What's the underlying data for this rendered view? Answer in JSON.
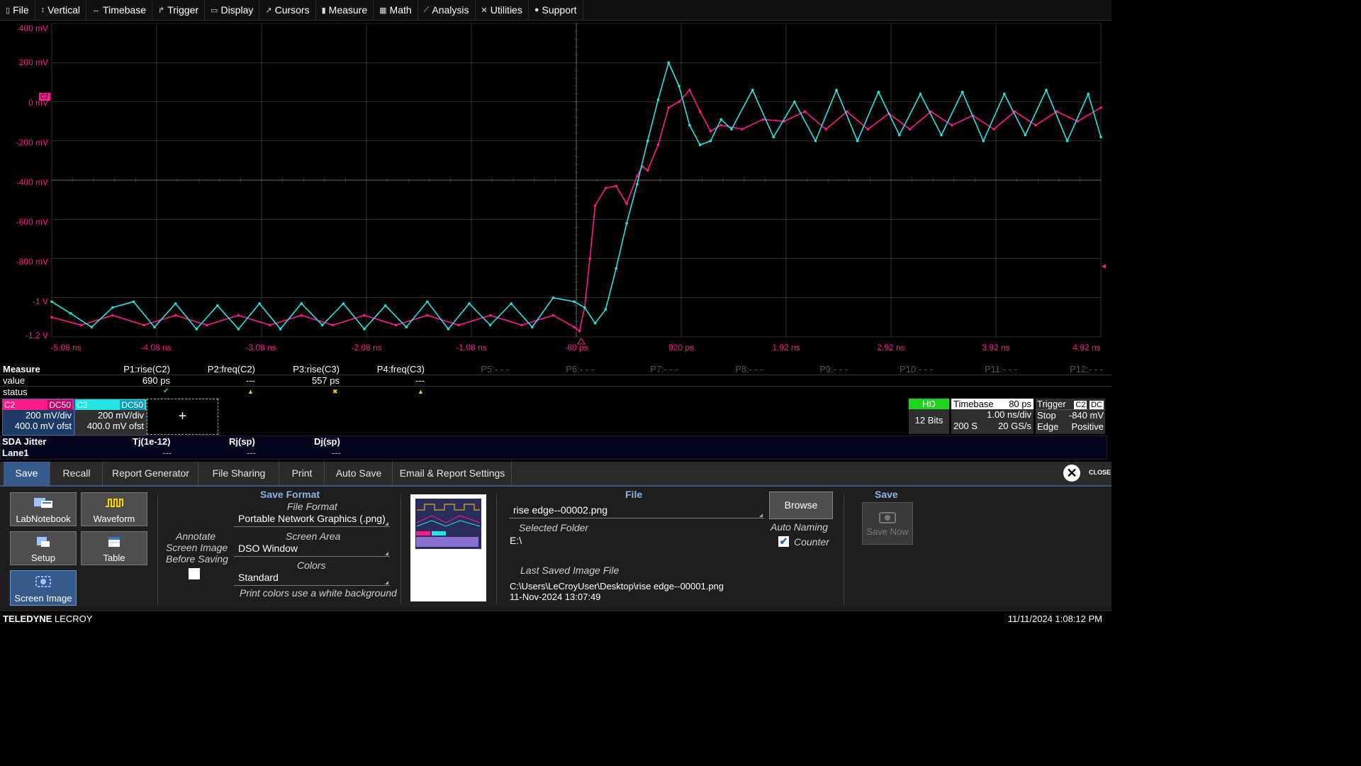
{
  "menu": [
    {
      "icon": "file-icon",
      "glyph": "▯",
      "label": "File"
    },
    {
      "icon": "vertical-icon",
      "glyph": "↕",
      "label": "Vertical"
    },
    {
      "icon": "timebase-icon",
      "glyph": "↔",
      "label": "Timebase"
    },
    {
      "icon": "trigger-icon",
      "glyph": "↱",
      "label": "Trigger"
    },
    {
      "icon": "display-icon",
      "glyph": "▭",
      "label": "Display"
    },
    {
      "icon": "cursors-icon",
      "glyph": "↗",
      "label": "Cursors"
    },
    {
      "icon": "measure-icon",
      "glyph": "▮",
      "label": "Measure"
    },
    {
      "icon": "math-icon",
      "glyph": "▦",
      "label": "Math"
    },
    {
      "icon": "analysis-icon",
      "glyph": "⟋",
      "label": "Analysis"
    },
    {
      "icon": "utilities-icon",
      "glyph": "✕",
      "label": "Utilities"
    },
    {
      "icon": "support-icon",
      "glyph": "●",
      "label": "Support"
    }
  ],
  "grid": {
    "y_labels": [
      "400 mV",
      "200 mV",
      "0 mV",
      "-200 mV",
      "-400 mV",
      "-600 mV",
      "-800 mV",
      "-1 V",
      "-1.2 V"
    ],
    "x_labels": [
      "-5.08 ns",
      "-4.08 ns",
      "-3.08 ns",
      "-2.08 ns",
      "-1.08 ns",
      "-80 ps",
      "920 ps",
      "1.92 ns",
      "2.92 ns",
      "3.92 ns",
      "4.92 ns"
    ],
    "c2_marker": "C2",
    "colors": {
      "c2": "#ff1a8c",
      "c3": "#22e5e5",
      "grid": "#555555"
    }
  },
  "chart_data": {
    "type": "line",
    "xlabel": "",
    "ylabel": "",
    "xlim": [
      -5.08,
      4.92
    ],
    "ylim": [
      -1.2,
      0.4
    ],
    "x_unit": "ns",
    "y_unit": "V",
    "series": [
      {
        "name": "C2",
        "color": "#ff1a8c",
        "x": [
          -5.08,
          -4.8,
          -4.5,
          -4.2,
          -3.9,
          -3.6,
          -3.3,
          -3.0,
          -2.7,
          -2.4,
          -2.1,
          -1.8,
          -1.5,
          -1.2,
          -0.9,
          -0.6,
          -0.3,
          -0.1,
          -0.05,
          0.0,
          0.05,
          0.1,
          0.2,
          0.3,
          0.4,
          0.5,
          0.55,
          0.6,
          0.7,
          0.8,
          0.9,
          1.0,
          1.1,
          1.2,
          1.3,
          1.5,
          1.7,
          1.9,
          2.1,
          2.3,
          2.5,
          2.7,
          2.9,
          3.1,
          3.3,
          3.5,
          3.7,
          3.9,
          4.1,
          4.3,
          4.5,
          4.7,
          4.92
        ],
        "y": [
          -1.1,
          -1.14,
          -1.09,
          -1.14,
          -1.09,
          -1.14,
          -1.09,
          -1.14,
          -1.09,
          -1.14,
          -1.09,
          -1.14,
          -1.09,
          -1.14,
          -1.09,
          -1.14,
          -1.09,
          -1.15,
          -1.17,
          -1.05,
          -0.8,
          -0.53,
          -0.44,
          -0.43,
          -0.52,
          -0.38,
          -0.33,
          -0.35,
          -0.22,
          -0.03,
          0.0,
          0.06,
          -0.05,
          -0.15,
          -0.12,
          -0.14,
          -0.09,
          -0.1,
          -0.05,
          -0.14,
          -0.05,
          -0.14,
          -0.06,
          -0.14,
          -0.05,
          -0.12,
          -0.07,
          -0.14,
          -0.05,
          -0.12,
          -0.05,
          -0.1,
          -0.03
        ]
      },
      {
        "name": "C3",
        "color": "#22e5e5",
        "x": [
          -5.08,
          -4.9,
          -4.7,
          -4.5,
          -4.3,
          -4.1,
          -3.9,
          -3.7,
          -3.5,
          -3.3,
          -3.1,
          -2.9,
          -2.7,
          -2.5,
          -2.3,
          -2.1,
          -1.9,
          -1.7,
          -1.5,
          -1.3,
          -1.1,
          -0.9,
          -0.7,
          -0.5,
          -0.3,
          -0.1,
          0.0,
          0.1,
          0.2,
          0.3,
          0.4,
          0.5,
          0.6,
          0.7,
          0.8,
          0.9,
          1.0,
          1.1,
          1.2,
          1.3,
          1.4,
          1.6,
          1.8,
          2.0,
          2.2,
          2.4,
          2.6,
          2.8,
          3.0,
          3.2,
          3.4,
          3.6,
          3.8,
          4.0,
          4.2,
          4.4,
          4.6,
          4.8,
          4.92
        ],
        "y": [
          -1.02,
          -1.08,
          -1.15,
          -1.05,
          -1.02,
          -1.15,
          -1.03,
          -1.16,
          -1.04,
          -1.16,
          -1.03,
          -1.16,
          -1.03,
          -1.14,
          -1.03,
          -1.16,
          -1.04,
          -1.15,
          -1.02,
          -1.16,
          -1.03,
          -1.14,
          -1.03,
          -1.15,
          -1.0,
          -1.02,
          -1.05,
          -1.13,
          -1.06,
          -0.85,
          -0.62,
          -0.42,
          -0.2,
          0.01,
          0.2,
          0.08,
          -0.12,
          -0.22,
          -0.2,
          -0.09,
          -0.14,
          0.06,
          -0.18,
          0.0,
          -0.2,
          0.06,
          -0.2,
          0.05,
          -0.17,
          0.04,
          -0.17,
          0.05,
          -0.2,
          0.04,
          -0.17,
          0.06,
          -0.2,
          0.04,
          -0.18
        ]
      }
    ]
  },
  "measure": {
    "row_labels": [
      "Measure",
      "value",
      "status"
    ],
    "params": [
      {
        "name": "P1:rise(C2)",
        "value": "690 ps",
        "status": "✔",
        "status_color": "#3bd13b"
      },
      {
        "name": "P2:freq(C2)",
        "value": "---",
        "status": "▲",
        "status_color": "#f4d21f"
      },
      {
        "name": "P3:rise(C3)",
        "value": "557 ps",
        "status": "✖",
        "status_color": "#f4d21f"
      },
      {
        "name": "P4:freq(C3)",
        "value": "---",
        "status": "▲",
        "status_color": "#f4d21f"
      },
      {
        "name": "P5:- - -",
        "value": "",
        "status": ""
      },
      {
        "name": "P6:- - -",
        "value": "",
        "status": ""
      },
      {
        "name": "P7:- - -",
        "value": "",
        "status": ""
      },
      {
        "name": "P8:- - -",
        "value": "",
        "status": ""
      },
      {
        "name": "P9:- - -",
        "value": "",
        "status": ""
      },
      {
        "name": "P10:- - -",
        "value": "",
        "status": ""
      },
      {
        "name": "P11:- - -",
        "value": "",
        "status": ""
      },
      {
        "name": "P12:- - -",
        "value": "",
        "status": ""
      }
    ]
  },
  "channels": {
    "c2": {
      "name": "C2",
      "coupling": "DC50",
      "vdiv": "200 mV/div",
      "offset": "400.0 mV ofst",
      "color": "#ff1a8c"
    },
    "c3": {
      "name": "C3",
      "coupling": "DC50",
      "vdiv": "200 mV/div",
      "offset": "400.0 mV ofst",
      "color": "#22e5e5"
    },
    "add_glyph": "+"
  },
  "status": {
    "hd": {
      "badge": "HD",
      "bits": "12 Bits"
    },
    "timebase": {
      "title": "Timebase",
      "delay": "80 ps",
      "rate": "1.00 ns/div",
      "samples": "200 S",
      "srate": "20 GS/s"
    },
    "trigger": {
      "title": "Trigger",
      "ch": "C2",
      "coupling": "DC",
      "mode": "Stop",
      "level": "-840 mV",
      "type": "Edge",
      "slope": "Positive"
    }
  },
  "sda": {
    "title": "SDA Jitter",
    "lane": "Lane1",
    "cols": [
      {
        "label": "Tj(1e-12)",
        "value": "---"
      },
      {
        "label": "Rj(sp)",
        "value": "---"
      },
      {
        "label": "Dj(sp)",
        "value": "---"
      }
    ]
  },
  "tabs": [
    "Save",
    "Recall",
    "Report Generator",
    "File Sharing",
    "Print",
    "Auto Save",
    "Email & Report Settings"
  ],
  "close_label": "CLOSE",
  "panel": {
    "buttons": [
      "LabNotebook",
      "Waveform",
      "Setup",
      "Table",
      "Screen Image"
    ],
    "annotate": [
      "Annotate",
      "Screen Image",
      "Before Saving"
    ],
    "save_format": {
      "title": "Save Format",
      "file_format_label": "File Format",
      "file_format_value": "Portable Network Graphics (.png)",
      "screen_area_label": "Screen Area",
      "screen_area_value": "DSO Window",
      "colors_label": "Colors",
      "colors_value": "Standard",
      "note": "Print colors use a white background"
    },
    "file": {
      "title": "File",
      "filename": "rise edge--00002.png",
      "selected_folder_label": "Selected Folder",
      "folder": "E:\\",
      "browse": "Browse",
      "auto_naming": "Auto Naming",
      "counter": "Counter",
      "last_saved_label": "Last Saved Image File",
      "last_saved_path": "C:\\Users\\LeCroyUser\\Desktop\\rise edge--00001.png",
      "last_saved_time": "11-Nov-2024 13:07:49"
    },
    "save": {
      "title": "Save",
      "button": "Save Now"
    }
  },
  "footer": {
    "brand_bold": "TELEDYNE",
    "brand_light": " LECROY",
    "datetime": "11/11/2024 1:08:12 PM"
  }
}
